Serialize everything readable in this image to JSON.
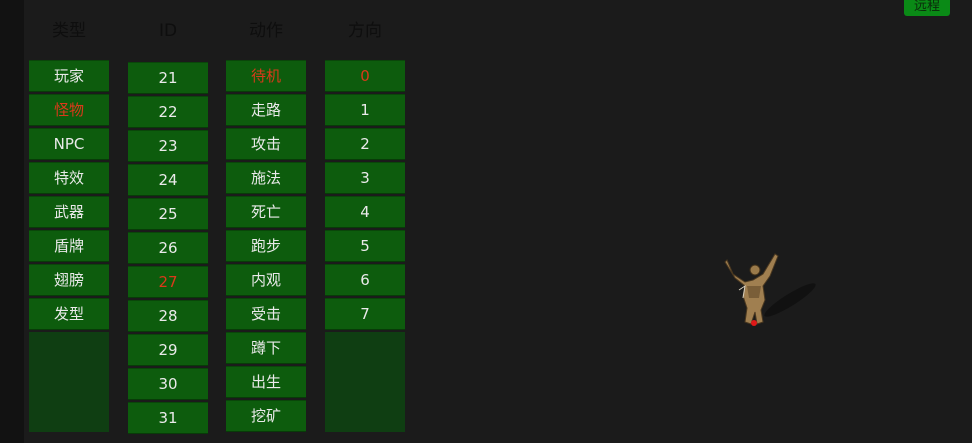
{
  "top_button": {
    "label": "远程"
  },
  "columns": [
    {
      "header": "类型",
      "items": [
        "玩家",
        "怪物",
        "NPC",
        "特效",
        "武器",
        "盾牌",
        "翅膀",
        "发型"
      ],
      "selected": 1
    },
    {
      "header": "ID",
      "items": [
        "21",
        "22",
        "23",
        "24",
        "25",
        "26",
        "27",
        "28",
        "29",
        "30",
        "31"
      ],
      "selected": 6
    },
    {
      "header": "动作",
      "items": [
        "待机",
        "走路",
        "攻击",
        "施法",
        "死亡",
        "跑步",
        "内观",
        "受击",
        "蹲下",
        "出生",
        "挖矿"
      ],
      "selected": 0
    },
    {
      "header": "方向",
      "items": [
        "0",
        "1",
        "2",
        "3",
        "4",
        "5",
        "6",
        "7"
      ],
      "selected": 0
    }
  ],
  "colors": {
    "cell_bg": "#0d5c0d",
    "cell_text": "#eaeaea",
    "selected_text": "#d93a1a",
    "filler_bg": "#0f3e12",
    "accent_button": "#0a8a16"
  },
  "preview": {
    "icon": "monster-sprite",
    "anchor_marker": "red-dot"
  }
}
